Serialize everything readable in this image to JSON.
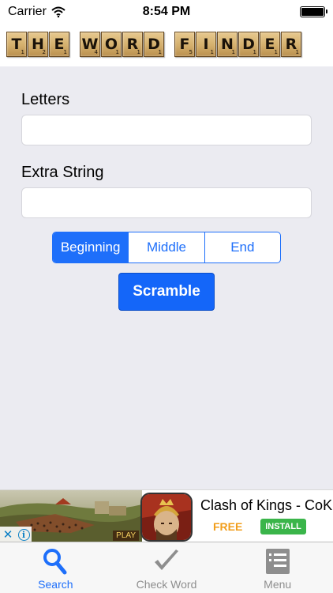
{
  "status_bar": {
    "carrier": "Carrier",
    "time": "8:54 PM"
  },
  "header": {
    "words": [
      {
        "tiles": [
          {
            "letter": "T",
            "points": "1"
          },
          {
            "letter": "H",
            "points": "2"
          },
          {
            "letter": "E",
            "points": "1"
          }
        ]
      },
      {
        "tiles": [
          {
            "letter": "W",
            "points": "4"
          },
          {
            "letter": "O",
            "points": "1"
          },
          {
            "letter": "R",
            "points": "1"
          },
          {
            "letter": "D",
            "points": "1"
          }
        ]
      },
      {
        "tiles": [
          {
            "letter": "F",
            "points": "5"
          },
          {
            "letter": "I",
            "points": "1"
          },
          {
            "letter": "N",
            "points": "1"
          },
          {
            "letter": "D",
            "points": "1"
          },
          {
            "letter": "E",
            "points": "1"
          },
          {
            "letter": "R",
            "points": "1"
          }
        ]
      }
    ]
  },
  "form": {
    "letters_label": "Letters",
    "letters_value": "",
    "extra_label": "Extra String",
    "extra_value": ""
  },
  "position_control": {
    "options": [
      "Beginning",
      "Middle",
      "End"
    ],
    "selected": "Beginning"
  },
  "scramble_label": "Scramble",
  "ad": {
    "title": "Clash of Kings - CoK",
    "price": "FREE",
    "install_label": "INSTALL",
    "close_glyph": "✕",
    "info_glyph": "i",
    "play_label": "PLAY"
  },
  "tabs": [
    {
      "label": "Search",
      "icon": "magnifier-icon",
      "active": true
    },
    {
      "label": "Check Word",
      "icon": "checkmark-icon",
      "active": false
    },
    {
      "label": "Menu",
      "icon": "menu-list-icon",
      "active": false
    }
  ],
  "colors": {
    "accent": "#1e6ffa",
    "background": "#ebebf1",
    "tile": "#d4af6c",
    "install_green": "#3ab54a",
    "free_orange": "#f19d1a"
  }
}
